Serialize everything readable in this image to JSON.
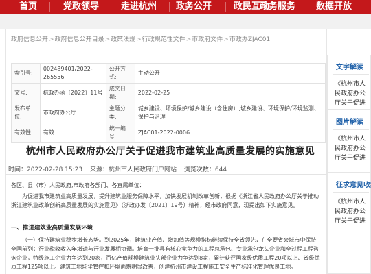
{
  "nav": {
    "items": [
      "首页",
      "党政领导",
      "走进杭州",
      "政务公开",
      "政民互动",
      "政务服务",
      "数据开放"
    ],
    "bg_color": "#c4181b"
  },
  "breadcrumb": [
    "政府信息公开",
    "政府信息公开目录",
    "政策法规",
    "行政规范性文件",
    "市政府文件",
    "市政办ZJAC01"
  ],
  "meta": {
    "index_label": "索引号:",
    "index_value": "002489401/2022-265556",
    "open_method_label": "公开方式:",
    "open_method_value": "主动公开",
    "doc_no_label": "文号:",
    "doc_no_value": "杭政办函〔2022〕11号",
    "date_label": "成文日期:",
    "date_value": "2022-02-25",
    "issuer_label": "发布单位:",
    "issuer_value": "市政府办公厅",
    "topic_label": "主题分类:",
    "topic_value": "城乡建设、环境保护/城乡建设（含住房）,城乡建设、环境保护/环境监测、保护与治理",
    "validity_label": "有效性:",
    "validity_value": "有效",
    "code_label": "统一编号:",
    "code_value": "ZJAC01-2022-0006"
  },
  "article": {
    "title": "杭州市人民政府办公厅关于促进我市建筑业高质量发展的实施意见",
    "time": "时间：2022-02-28 15:23",
    "source": "来源：杭州市人民政府门户网站",
    "views": "浏览次数：644",
    "p1": "各区、县（市）人民政府,市政府各部门、各直属单位：",
    "p2": "为促进我市建筑业高质量发展，提升建筑业服务保障水平，加快发展机制改革创新，根据《浙江省人民政府办公厅关于推动浙江建筑业改革创新高质量发展的实施意见》（浙政办发〔2021〕19号）精神，经市政府同意，现提出如下实施意见。",
    "section1": "一、推进建筑业高质量发展环境",
    "p3": "（一）保持建筑业稳步增长态势。到2025年，建筑业产值、增加值等规模指标继续保持全省领先，在全要省会城市中保持全国前列；行业税收收入年增速与行业发展相协调。培育一批具有核心竞争力的工程总承包、专业承包龙头企业和全过程工程咨询企业，特级施工企业力争达到20家，百亿产值规模建筑业头部企业力争达到8家，累计获评国家级优质工程20项以上、省级优质工程125项以上。建筑工地场尘管控和环境面貌明显改善，创建杭州市建设工程施工安全生产标准化管理优良工地。"
  },
  "sidebar": {
    "sections": [
      {
        "heading": "文字解读",
        "link": "《杭州市人民政府办公厅关于促进我市建筑业高质量发展的实施意见》解读"
      },
      {
        "heading": "图片解读",
        "link": "《杭州市人民政府办公厅关于促进我市建筑业高质量发展的实施意见》图解"
      },
      {
        "heading": "征求意见收集",
        "link": "《杭州市人民政府办公厅关于促进我市建筑业高质量发展的实施意见》意见征求采集采纳情况"
      }
    ]
  }
}
